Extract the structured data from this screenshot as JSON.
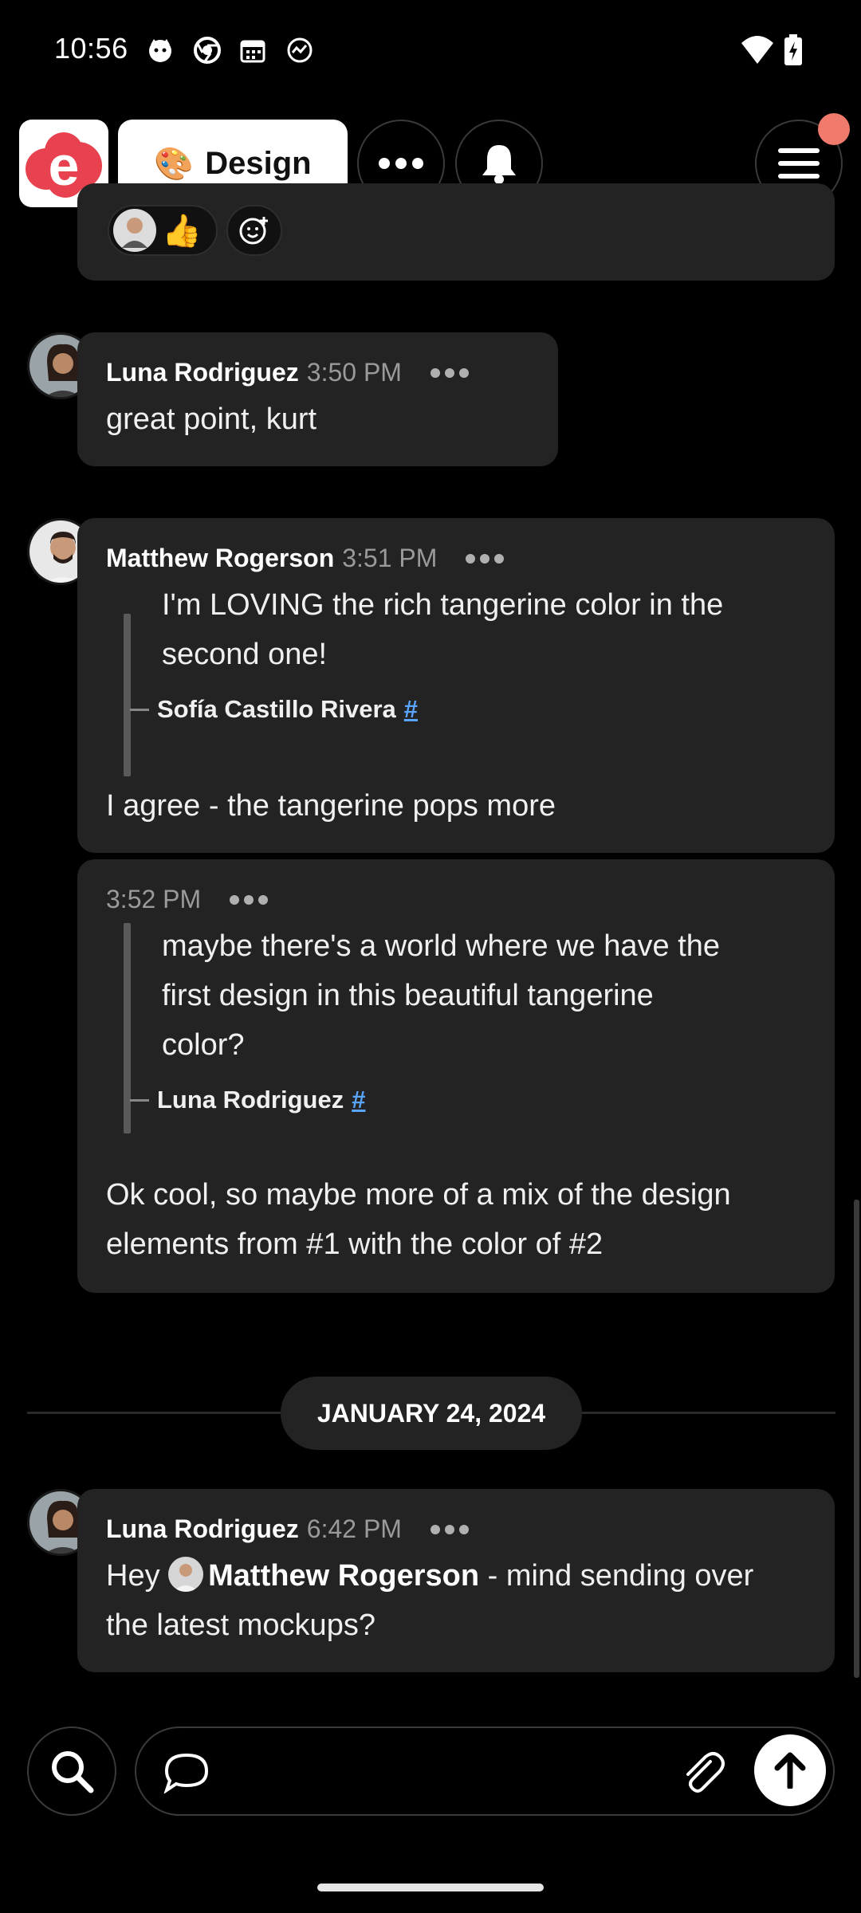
{
  "status_bar": {
    "time": "10:56"
  },
  "header": {
    "channel_emoji": "🎨",
    "channel_name": "Design"
  },
  "reactions": {
    "thumbs": "👍"
  },
  "messages": [
    {
      "author": "Luna Rodriguez",
      "time": "3:50 PM",
      "text": "great point, kurt"
    },
    {
      "author": "Matthew Rogerson",
      "time": "3:51 PM",
      "quote_lines": [
        "I'm LOVING the rich tangerine color in the",
        "second one!"
      ],
      "quote_author": "Sofía Castillo Rivera",
      "quote_link": "#",
      "text": "I agree - the tangerine pops more"
    },
    {
      "time": "3:52 PM",
      "quote_lines": [
        "maybe there's a world where we have the",
        "first design in this beautiful tangerine",
        "color?"
      ],
      "quote_author": "Luna Rodriguez",
      "quote_link": "#",
      "text_lines": [
        "Ok cool, so maybe more of a mix of the design",
        "elements from #1 with the color of #2"
      ]
    },
    {
      "author": "Luna Rodriguez",
      "time": "6:42 PM",
      "text_prefix": "Hey ",
      "mention": "Matthew Rogerson",
      "text_suffix": " - mind sending over",
      "text_line2": "the latest mockups?"
    }
  ],
  "date_divider": "JANUARY 24, 2024",
  "colors": {
    "notification": "#f07a6c",
    "link": "#5aa5ff",
    "brand": "#e8414f"
  }
}
